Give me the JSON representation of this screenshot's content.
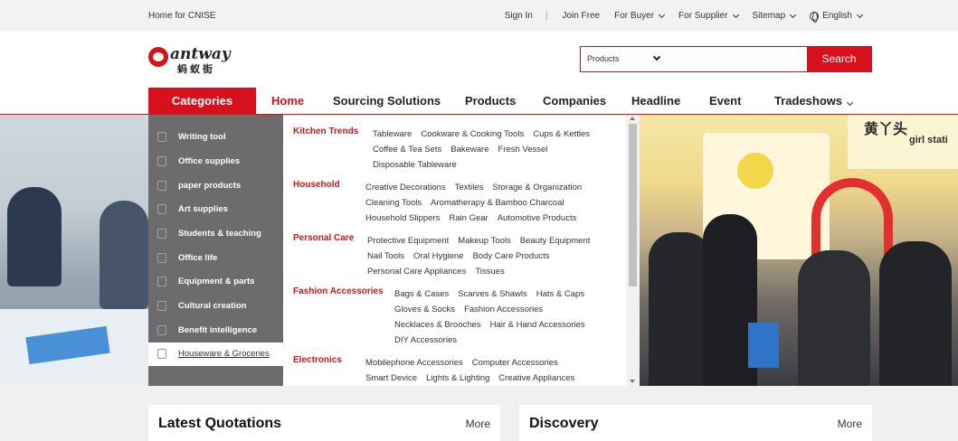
{
  "topbar": {
    "home": "Home for CNISE",
    "sign_in": "Sign In",
    "separator": "|",
    "join_free": "Join Free",
    "for_buyer": "For Buyer",
    "for_supplier": "For Supplier",
    "sitemap": "Sitemap",
    "language": "English"
  },
  "logo": {
    "brand": "antway",
    "cn": "蚂蚁街"
  },
  "search": {
    "category": "Products",
    "placeholder": "",
    "button": "Search"
  },
  "nav": {
    "categories": "Categories",
    "items": [
      "Home",
      "Sourcing Solutions",
      "Products",
      "Companies",
      "Headline",
      "Event",
      "Tradeshows"
    ]
  },
  "sidebar": {
    "items": [
      "Writing tool",
      "Office supplies",
      "paper products",
      "Art supplies",
      "Students & teaching",
      "Office life",
      "Equipment & parts",
      "Cultural creation",
      "Benefit intelligence",
      "Houseware & Groceries"
    ]
  },
  "dropdown": {
    "groups": [
      {
        "title": "Kitchen Trends",
        "lines": [
          [
            "Tableware",
            "Cookware & Cooking Tools",
            "Cups & Kettles"
          ],
          [
            "Coffee & Tea Sets",
            "Bakeware",
            "Fresh Vessel"
          ],
          [
            "Disposable Tableware"
          ]
        ]
      },
      {
        "title": "Household",
        "lines": [
          [
            "Creative Decorations",
            "Textiles",
            "Storage & Organization"
          ],
          [
            "Cleaning Tools",
            "Aromatherapy & Bamboo Charcoal"
          ],
          [
            "Household Slippers",
            "Rain Gear",
            "Automotive Products"
          ]
        ]
      },
      {
        "title": "Personal Care",
        "lines": [
          [
            "Protective Equipment",
            "Makeup Tools",
            "Beauty Equipment"
          ],
          [
            "Nail Tools",
            "Oral Hygiene",
            "Body Care Products"
          ],
          [
            "Personal Care Appliances",
            "Tissues"
          ]
        ]
      },
      {
        "title": "Fashion Accessories",
        "lines": [
          [
            "Bags & Cases",
            "Scarves & Shawls",
            "Hats & Caps"
          ],
          [
            "Gloves & Socks",
            "Fashion Accessories"
          ],
          [
            "Necklaces & Brooches",
            "Hair & Hand Accessories"
          ],
          [
            "DIY Accessories"
          ]
        ]
      },
      {
        "title": "Electronics",
        "lines": [
          [
            "Mobilephone Accessories",
            "Computer Accessories"
          ],
          [
            "Smart Device",
            "Lights & Lighting",
            "Creative Appliances"
          ]
        ]
      }
    ]
  },
  "banner": {
    "sign_text": "黄丫头",
    "sign_text2": "girl stati"
  },
  "cards": [
    {
      "title": "Latest Quotations",
      "more": "More"
    },
    {
      "title": "Discovery",
      "more": "More"
    }
  ],
  "colors": {
    "brand_red": "#d7111b",
    "link_red": "#c8161d"
  }
}
